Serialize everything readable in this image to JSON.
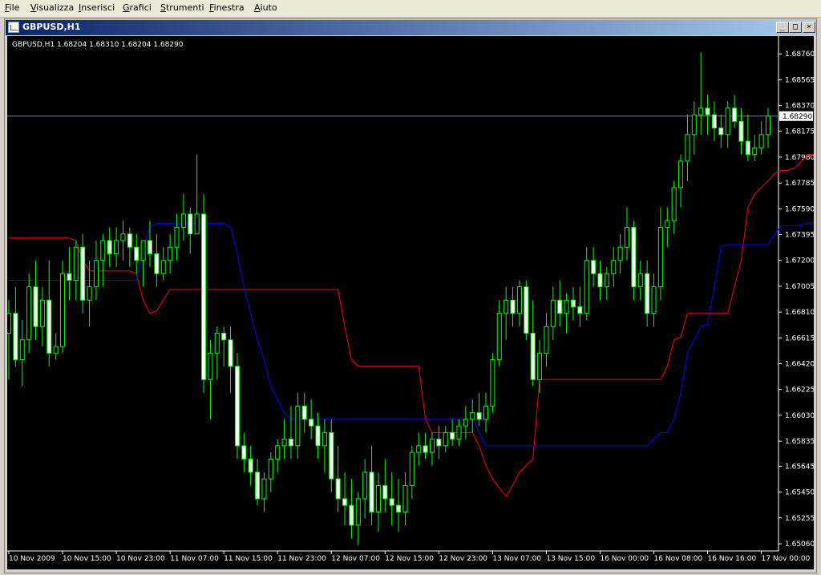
{
  "menu": {
    "items": [
      "File",
      "Visualizza",
      "Inserisci",
      "Grafici",
      "Strumenti",
      "Finestra",
      "Aiuto"
    ]
  },
  "window": {
    "title": "GBPUSD,H1",
    "minimize_glyph": "_",
    "restore_glyph": "□",
    "close_glyph": "×"
  },
  "chart": {
    "info": "GBPUSD,H1  1.68204 1.68310 1.68204 1.68290"
  },
  "colors": {
    "background": "#000000",
    "bull_candle": "#00ff00",
    "bull_body": "#ffffff",
    "bear_body": "#ffffff",
    "red_line": "#ff0000",
    "blue_line": "#0000ff",
    "price_line": "#708090"
  },
  "chart_data": {
    "type": "candlestick",
    "symbol": "GBPUSD",
    "timeframe": "H1",
    "last_price": "1.68290",
    "y_ticks": [
      "1.68760",
      "1.68565",
      "1.68370",
      "1.68175",
      "1.67980",
      "1.67785",
      "1.67590",
      "1.67395",
      "1.67200",
      "1.67005",
      "1.66810",
      "1.66615",
      "1.66420",
      "1.66225",
      "1.66030",
      "1.65835",
      "1.65645",
      "1.65450",
      "1.65255",
      "1.65060"
    ],
    "x_ticks": [
      "10 Nov 2009",
      "10 Nov 15:00",
      "10 Nov 23:00",
      "11 Nov 07:00",
      "11 Nov 15:00",
      "11 Nov 23:00",
      "12 Nov 07:00",
      "12 Nov 15:00",
      "12 Nov 23:00",
      "13 Nov 07:00",
      "13 Nov 15:00",
      "16 Nov 00:00",
      "16 Nov 08:00",
      "16 Nov 16:00",
      "17 Nov 00:00"
    ],
    "ylim": [
      1.6503,
      1.6887
    ],
    "grid": false,
    "candles": [
      [
        1.6665,
        1.669,
        1.663,
        1.668
      ],
      [
        1.668,
        1.67,
        1.664,
        1.6645
      ],
      [
        1.6645,
        1.6675,
        1.6625,
        1.666
      ],
      [
        1.666,
        1.671,
        1.665,
        1.67
      ],
      [
        1.67,
        1.672,
        1.666,
        1.667
      ],
      [
        1.667,
        1.67,
        1.6655,
        1.669
      ],
      [
        1.669,
        1.672,
        1.664,
        1.665
      ],
      [
        1.665,
        1.6665,
        1.6645,
        1.6655
      ],
      [
        1.6655,
        1.672,
        1.665,
        1.671
      ],
      [
        1.671,
        1.673,
        1.669,
        1.6705
      ],
      [
        1.6705,
        1.6735,
        1.669,
        1.673
      ],
      [
        1.673,
        1.674,
        1.668,
        1.669
      ],
      [
        1.669,
        1.672,
        1.667,
        1.67
      ],
      [
        1.67,
        1.6735,
        1.669,
        1.672
      ],
      [
        1.672,
        1.674,
        1.67,
        1.6735
      ],
      [
        1.6735,
        1.6745,
        1.6715,
        1.6725
      ],
      [
        1.6725,
        1.6745,
        1.6715,
        1.6735
      ],
      [
        1.6735,
        1.675,
        1.672,
        1.674
      ],
      [
        1.674,
        1.6745,
        1.6715,
        1.673
      ],
      [
        1.673,
        1.674,
        1.671,
        1.672
      ],
      [
        1.672,
        1.6735,
        1.67,
        1.6735
      ],
      [
        1.6735,
        1.675,
        1.6715,
        1.6725
      ],
      [
        1.6725,
        1.674,
        1.67,
        1.671
      ],
      [
        1.671,
        1.673,
        1.6705,
        1.672
      ],
      [
        1.672,
        1.674,
        1.671,
        1.673
      ],
      [
        1.673,
        1.6755,
        1.672,
        1.6745
      ],
      [
        1.6745,
        1.677,
        1.6735,
        1.6755
      ],
      [
        1.6755,
        1.676,
        1.6725,
        1.674
      ],
      [
        1.674,
        1.68,
        1.674,
        1.6755
      ],
      [
        1.6755,
        1.677,
        1.662,
        1.663
      ],
      [
        1.663,
        1.666,
        1.66,
        1.665
      ],
      [
        1.665,
        1.667,
        1.663,
        1.6665
      ],
      [
        1.6665,
        1.667,
        1.664,
        1.666
      ],
      [
        1.666,
        1.667,
        1.662,
        1.664
      ],
      [
        1.664,
        1.665,
        1.657,
        1.658
      ],
      [
        1.658,
        1.659,
        1.656,
        1.657
      ],
      [
        1.657,
        1.658,
        1.655,
        1.656
      ],
      [
        1.656,
        1.657,
        1.6535,
        1.654
      ],
      [
        1.654,
        1.656,
        1.653,
        1.6555
      ],
      [
        1.6555,
        1.6575,
        1.6545,
        1.657
      ],
      [
        1.657,
        1.6585,
        1.656,
        1.658
      ],
      [
        1.658,
        1.66,
        1.657,
        1.6585
      ],
      [
        1.6585,
        1.661,
        1.657,
        1.658
      ],
      [
        1.658,
        1.662,
        1.657,
        1.661
      ],
      [
        1.661,
        1.662,
        1.659,
        1.66
      ],
      [
        1.66,
        1.6615,
        1.6585,
        1.6595
      ],
      [
        1.6595,
        1.6605,
        1.657,
        1.658
      ],
      [
        1.658,
        1.66,
        1.656,
        1.659
      ],
      [
        1.659,
        1.66,
        1.6545,
        1.6555
      ],
      [
        1.6555,
        1.658,
        1.653,
        1.654
      ],
      [
        1.654,
        1.656,
        1.652,
        1.6535
      ],
      [
        1.6535,
        1.6555,
        1.651,
        1.652
      ],
      [
        1.652,
        1.6545,
        1.6505,
        1.654
      ],
      [
        1.654,
        1.657,
        1.6525,
        1.656
      ],
      [
        1.656,
        1.658,
        1.652,
        1.653
      ],
      [
        1.653,
        1.656,
        1.6515,
        1.655
      ],
      [
        1.655,
        1.657,
        1.653,
        1.654
      ],
      [
        1.654,
        1.656,
        1.652,
        1.6535
      ],
      [
        1.6535,
        1.6555,
        1.6515,
        1.653
      ],
      [
        1.653,
        1.656,
        1.652,
        1.655
      ],
      [
        1.655,
        1.658,
        1.654,
        1.6575
      ],
      [
        1.6575,
        1.659,
        1.6565,
        1.658
      ],
      [
        1.658,
        1.659,
        1.657,
        1.6575
      ],
      [
        1.6575,
        1.659,
        1.6565,
        1.6585
      ],
      [
        1.6585,
        1.6595,
        1.657,
        1.658
      ],
      [
        1.658,
        1.6595,
        1.6575,
        1.659
      ],
      [
        1.659,
        1.66,
        1.658,
        1.6585
      ],
      [
        1.6585,
        1.66,
        1.658,
        1.6595
      ],
      [
        1.6595,
        1.661,
        1.6585,
        1.66
      ],
      [
        1.66,
        1.6615,
        1.659,
        1.6605
      ],
      [
        1.6605,
        1.662,
        1.6595,
        1.66
      ],
      [
        1.66,
        1.662,
        1.659,
        1.661
      ],
      [
        1.661,
        1.665,
        1.6605,
        1.6645
      ],
      [
        1.6645,
        1.669,
        1.664,
        1.668
      ],
      [
        1.668,
        1.67,
        1.666,
        1.669
      ],
      [
        1.669,
        1.67,
        1.667,
        1.668
      ],
      [
        1.668,
        1.6705,
        1.667,
        1.67
      ],
      [
        1.67,
        1.6705,
        1.666,
        1.6665
      ],
      [
        1.6665,
        1.669,
        1.6625,
        1.663
      ],
      [
        1.663,
        1.666,
        1.662,
        1.665
      ],
      [
        1.665,
        1.668,
        1.664,
        1.667
      ],
      [
        1.667,
        1.67,
        1.666,
        1.669
      ],
      [
        1.669,
        1.6705,
        1.667,
        1.668
      ],
      [
        1.668,
        1.6695,
        1.6665,
        1.669
      ],
      [
        1.669,
        1.67,
        1.6675,
        1.6685
      ],
      [
        1.6685,
        1.67,
        1.667,
        1.668
      ],
      [
        1.668,
        1.673,
        1.6675,
        1.672
      ],
      [
        1.672,
        1.673,
        1.67,
        1.671
      ],
      [
        1.671,
        1.672,
        1.669,
        1.67
      ],
      [
        1.67,
        1.6715,
        1.669,
        1.671
      ],
      [
        1.671,
        1.673,
        1.67,
        1.672
      ],
      [
        1.672,
        1.674,
        1.671,
        1.673
      ],
      [
        1.673,
        1.676,
        1.672,
        1.6745
      ],
      [
        1.6745,
        1.675,
        1.669,
        1.67
      ],
      [
        1.67,
        1.672,
        1.669,
        1.671
      ],
      [
        1.671,
        1.672,
        1.667,
        1.668
      ],
      [
        1.668,
        1.671,
        1.667,
        1.67
      ],
      [
        1.67,
        1.676,
        1.669,
        1.6745
      ],
      [
        1.6745,
        1.676,
        1.673,
        1.675
      ],
      [
        1.675,
        1.678,
        1.674,
        1.6775
      ],
      [
        1.6775,
        1.68,
        1.676,
        1.6795
      ],
      [
        1.6795,
        1.683,
        1.678,
        1.6815
      ],
      [
        1.6815,
        1.684,
        1.68,
        1.683
      ],
      [
        1.683,
        1.6877,
        1.6815,
        1.6835
      ],
      [
        1.6835,
        1.6845,
        1.6815,
        1.683
      ],
      [
        1.683,
        1.684,
        1.681,
        1.682
      ],
      [
        1.682,
        1.683,
        1.6805,
        1.6815
      ],
      [
        1.6815,
        1.684,
        1.6805,
        1.6835
      ],
      [
        1.6835,
        1.6845,
        1.682,
        1.6825
      ],
      [
        1.6825,
        1.6835,
        1.68,
        1.681
      ],
      [
        1.681,
        1.683,
        1.6795,
        1.68
      ],
      [
        1.68,
        1.6815,
        1.6795,
        1.6805
      ],
      [
        1.6805,
        1.6825,
        1.68,
        1.6815
      ],
      [
        1.6815,
        1.6835,
        1.6805,
        1.6829
      ]
    ],
    "red_line": [
      1.6737,
      1.6737,
      1.6737,
      1.6737,
      1.6737,
      1.6737,
      1.6737,
      1.6737,
      1.6737,
      1.6737,
      1.6735,
      1.672,
      1.6712,
      1.6712,
      1.6712,
      1.6712,
      1.6712,
      1.6712,
      1.6712,
      1.671,
      1.669,
      1.668,
      1.6682,
      1.669,
      1.6698,
      1.6698,
      1.6698,
      1.6698,
      1.6698,
      1.6698,
      1.6698,
      1.6698,
      1.6698,
      1.6698,
      1.6698,
      1.6698,
      1.6698,
      1.6698,
      1.6698,
      1.6698,
      1.6698,
      1.6698,
      1.6698,
      1.6698,
      1.6698,
      1.6698,
      1.6698,
      1.6698,
      1.6698,
      1.6698,
      1.667,
      1.6645,
      1.664,
      1.664,
      1.664,
      1.664,
      1.664,
      1.664,
      1.664,
      1.664,
      1.664,
      1.664,
      1.66,
      1.659,
      1.659,
      1.659,
      1.659,
      1.659,
      1.659,
      1.659,
      1.658,
      1.6565,
      1.6555,
      1.6548,
      1.6542,
      1.655,
      1.656,
      1.6565,
      1.657,
      1.663,
      1.663,
      1.663,
      1.663,
      1.663,
      1.663,
      1.663,
      1.663,
      1.663,
      1.663,
      1.663,
      1.663,
      1.663,
      1.663,
      1.663,
      1.663,
      1.663,
      1.663,
      1.663,
      1.664,
      1.666,
      1.6662,
      1.668,
      1.668,
      1.668,
      1.668,
      1.668,
      1.668,
      1.668,
      1.67,
      1.672,
      1.676,
      1.677,
      1.6775,
      1.678,
      1.6786,
      1.6788,
      1.6788,
      1.679,
      1.6795,
      1.68,
      1.68
    ],
    "blue_line": [
      1.6705,
      1.6705,
      1.6705,
      1.6705,
      1.6705,
      1.6705,
      1.6705,
      1.6705,
      1.6705,
      1.6705,
      1.6705,
      1.6705,
      1.6705,
      1.6705,
      1.6705,
      1.6705,
      1.6705,
      1.6705,
      1.6705,
      1.6705,
      1.673,
      1.6745,
      1.6748,
      1.6748,
      1.6748,
      1.6748,
      1.6748,
      1.6748,
      1.6748,
      1.6748,
      1.6748,
      1.6748,
      1.6748,
      1.6745,
      1.6725,
      1.67,
      1.668,
      1.666,
      1.6645,
      1.6625,
      1.6615,
      1.6605,
      1.66,
      1.66,
      1.66,
      1.66,
      1.66,
      1.66,
      1.66,
      1.66,
      1.66,
      1.66,
      1.66,
      1.66,
      1.66,
      1.66,
      1.66,
      1.66,
      1.66,
      1.66,
      1.66,
      1.66,
      1.66,
      1.66,
      1.66,
      1.66,
      1.66,
      1.66,
      1.66,
      1.6602,
      1.659,
      1.658,
      1.658,
      1.658,
      1.658,
      1.658,
      1.658,
      1.658,
      1.658,
      1.658,
      1.658,
      1.658,
      1.658,
      1.658,
      1.658,
      1.658,
      1.658,
      1.658,
      1.658,
      1.658,
      1.658,
      1.658,
      1.658,
      1.658,
      1.658,
      1.658,
      1.6585,
      1.659,
      1.659,
      1.66,
      1.662,
      1.665,
      1.666,
      1.667,
      1.6672,
      1.67,
      1.673,
      1.6732,
      1.6732,
      1.6732,
      1.6732,
      1.6732,
      1.6732,
      1.6732,
      1.674,
      1.6746,
      1.6746,
      1.6746,
      1.6747,
      1.6748,
      1.6749,
      1.6749,
      1.6749
    ]
  }
}
